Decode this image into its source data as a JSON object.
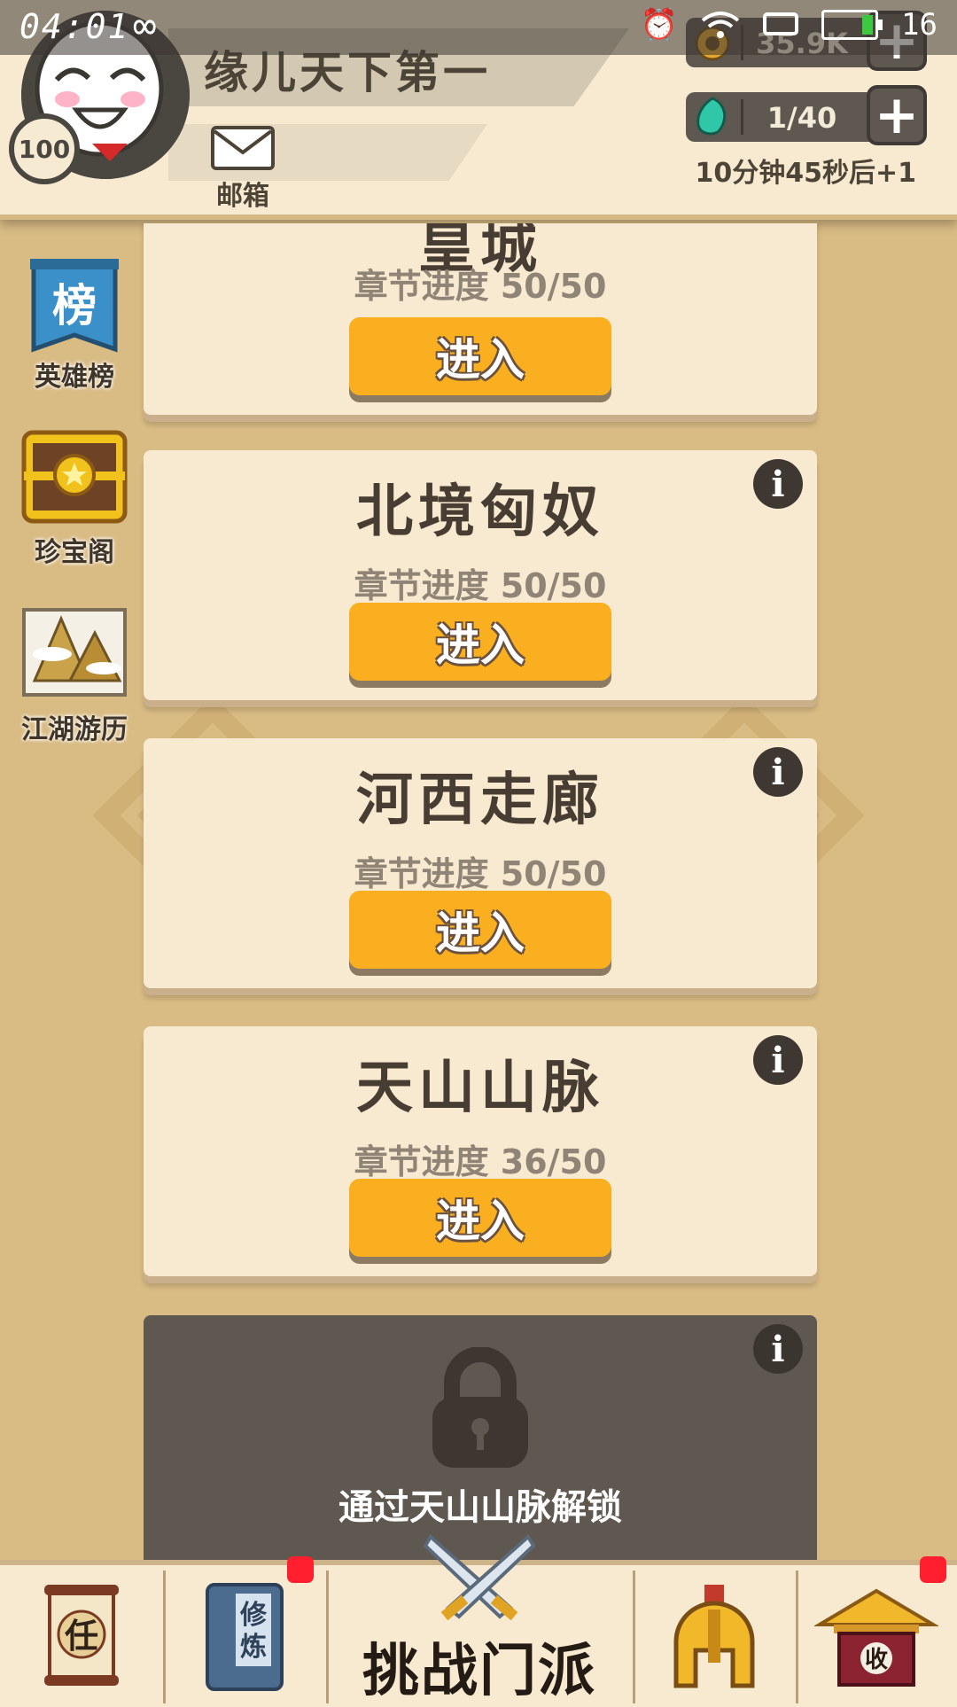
{
  "status_bar": {
    "time": "04:01",
    "battery_text": "16"
  },
  "header": {
    "player_name": "缘儿天下第一",
    "level": "100",
    "mail_label": "邮箱",
    "coins": "35.9K",
    "energy": "1/40",
    "energy_timer": "10分钟45秒后+1"
  },
  "side_menu": [
    {
      "label": "英雄榜",
      "icon": "ranking-banner-icon",
      "icon_char": "榜"
    },
    {
      "label": "珍宝阁",
      "icon": "treasure-chest-icon"
    },
    {
      "label": "江湖游历",
      "icon": "mountain-scroll-icon"
    }
  ],
  "chapters": [
    {
      "title": "皇城",
      "progress": "章节进度 50/50",
      "button": "进入"
    },
    {
      "title": "北境匈奴",
      "progress": "章节进度 50/50",
      "button": "进入"
    },
    {
      "title": "河西走廊",
      "progress": "章节进度 50/50",
      "button": "进入"
    },
    {
      "title": "天山山脉",
      "progress": "章节进度 36/50",
      "button": "进入"
    }
  ],
  "locked_chapter": {
    "unlock_text": "通过天山山脉解锁"
  },
  "bottom_nav": {
    "task_char": "任",
    "practice_chars": "修炼",
    "challenge_label": "挑战门派",
    "collect_char": "收"
  },
  "colors": {
    "background": "#d9bb84",
    "card": "#f8ead0",
    "enter_button": "#f9af1f",
    "locked_card": "#5f5850",
    "notification": "#ff1f2f"
  }
}
